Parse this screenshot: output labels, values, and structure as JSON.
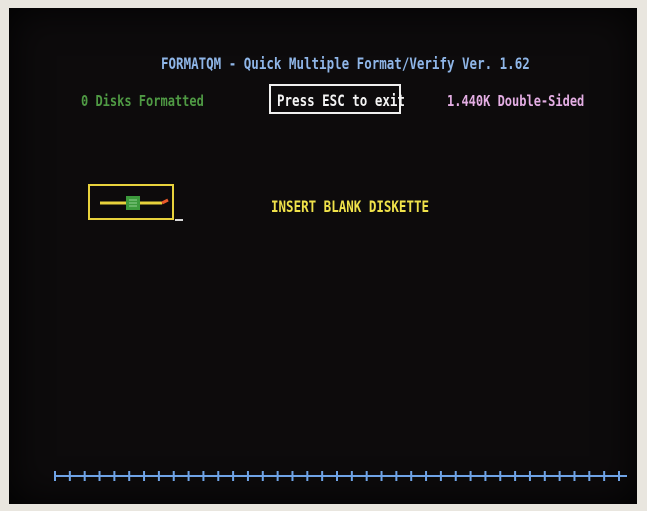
{
  "header": {
    "title": "FORMATQM - Quick Multiple Format/Verify  Ver. 1.62"
  },
  "status": {
    "disks_formatted": "0 Disks Formatted",
    "exit_prompt": "Press ESC to exit",
    "format_type": "1.440K Double-Sided"
  },
  "main": {
    "message": "INSERT BLANK DISKETTE"
  },
  "progress": {
    "segments": 38,
    "filled_fraction": 0
  },
  "colors": {
    "background": "#0d0b0c",
    "title": "#8fb6e8",
    "count": "#4f9a44",
    "exit": "#f4f4f4",
    "format_type": "#e4aee4",
    "message": "#f0e24a",
    "drive_frame": "#e8d23c",
    "progress_line": "#6fa3e6"
  },
  "icons": {
    "drive": "floppy-drive-icon"
  }
}
